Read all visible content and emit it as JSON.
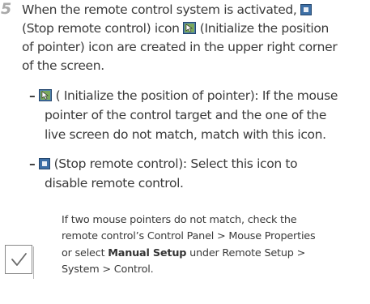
{
  "step": {
    "number": "5",
    "line1": "When the remote control system is activated,",
    "line2_a": "(Stop remote control) icon",
    "line2_b": "(Initialize the position",
    "line3": "of pointer) icon are created in the upper right corner",
    "line4": "of the screen."
  },
  "bullet1": {
    "dash": "–",
    "line1": "( Initialize the position of pointer): If the mouse",
    "line2": "pointer of the control target and the one of the",
    "line3": "live screen do not match, match with this icon."
  },
  "bullet2": {
    "dash": "–",
    "line1": "(Stop remote control): Select this icon to",
    "line2": "disable remote control."
  },
  "note": {
    "line1": "If two mouse pointers do not match, check the",
    "line2": "remote control’s Control Panel > Mouse Properties",
    "line3_pre": "or select ",
    "line3_bold": "Manual Setup",
    "line3_post": " under Remote Setup >",
    "line4": "System > Control."
  },
  "icons": {
    "stop": "stop-remote-control-icon",
    "init": "initialize-pointer-icon",
    "check": "check-icon"
  }
}
